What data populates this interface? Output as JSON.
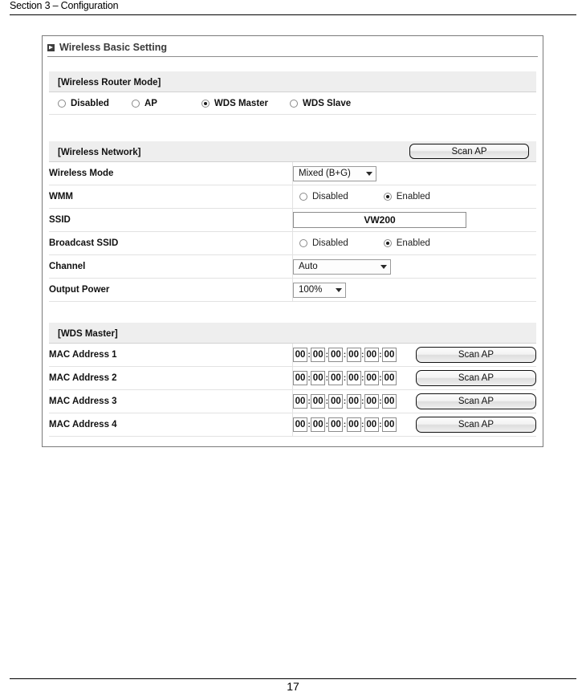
{
  "document": {
    "header_text": "Section 3 – Configuration",
    "page_number": "17"
  },
  "panel": {
    "title": "Wireless Basic Setting",
    "title_icon": "expander-box-icon"
  },
  "router_mode": {
    "section_label": "[Wireless Router Mode]",
    "options": [
      {
        "label": "Disabled",
        "selected": false
      },
      {
        "label": "AP",
        "selected": false
      },
      {
        "label": "WDS Master",
        "selected": true
      },
      {
        "label": "WDS Slave",
        "selected": false
      }
    ]
  },
  "wireless_network": {
    "section_label": "[Wireless Network]",
    "scan_ap_label": "Scan AP",
    "rows": {
      "wireless_mode": {
        "label": "Wireless Mode",
        "value": "Mixed (B+G)"
      },
      "wmm": {
        "label": "WMM",
        "options": [
          {
            "label": "Disabled",
            "selected": false
          },
          {
            "label": "Enabled",
            "selected": true
          }
        ]
      },
      "ssid": {
        "label": "SSID",
        "value": "VW200"
      },
      "broadcast_ssid": {
        "label": "Broadcast SSID",
        "options": [
          {
            "label": "Disabled",
            "selected": false
          },
          {
            "label": "Enabled",
            "selected": true
          }
        ]
      },
      "channel": {
        "label": "Channel",
        "value": "Auto"
      },
      "output_power": {
        "label": "Output Power",
        "value": "100%"
      }
    }
  },
  "wds_master": {
    "section_label": "[WDS Master]",
    "scan_ap_label": "Scan AP",
    "mac_separator": ":",
    "rows": [
      {
        "label": "MAC Address 1",
        "octets": [
          "00",
          "00",
          "00",
          "00",
          "00",
          "00"
        ]
      },
      {
        "label": "MAC Address 2",
        "octets": [
          "00",
          "00",
          "00",
          "00",
          "00",
          "00"
        ]
      },
      {
        "label": "MAC Address 3",
        "octets": [
          "00",
          "00",
          "00",
          "00",
          "00",
          "00"
        ]
      },
      {
        "label": "MAC Address 4",
        "octets": [
          "00",
          "00",
          "00",
          "00",
          "00",
          "00"
        ]
      }
    ]
  }
}
